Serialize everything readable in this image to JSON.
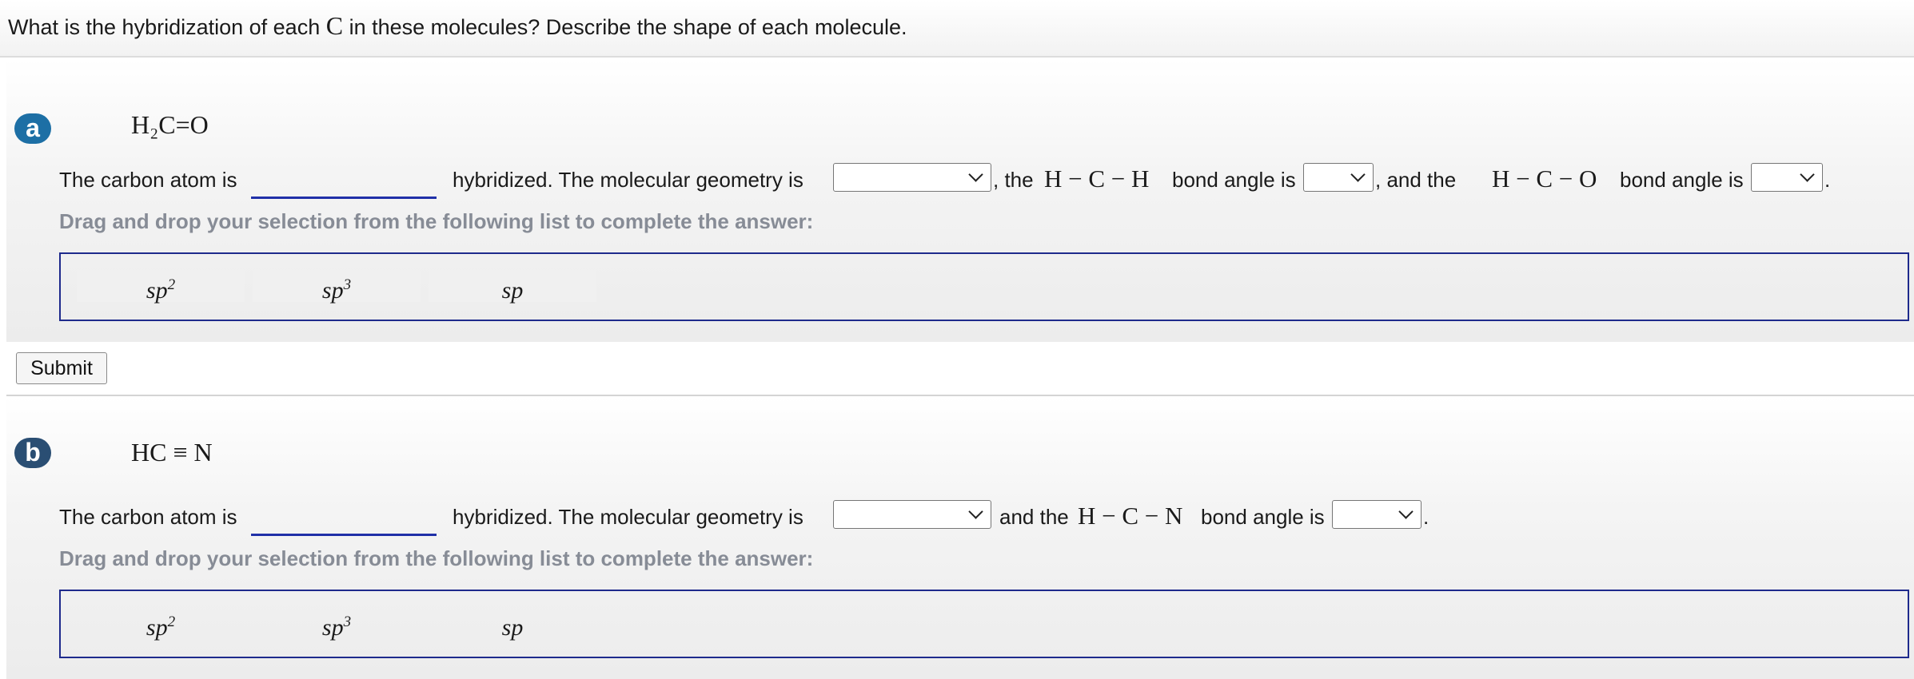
{
  "question": {
    "prefix": "What is the hybridization of each",
    "atom": "C",
    "suffix": "in these molecules? Describe the shape of each molecule."
  },
  "parts": [
    {
      "badge": "a",
      "formula": "H₂C=O",
      "carbon_text": "The carbon atom is",
      "hybrid_text": "hybridized. The molecular geometry is",
      "angle1_pre": ", the",
      "angle1_label": "H − C − H",
      "angle1_post": "bond angle is",
      "angle2_pre": ", and the",
      "angle2_label": "H − C − O",
      "angle2_post": "bond angle is",
      "end": ".",
      "instruction": "Drag and drop your selection from the following list to complete the answer:",
      "choices": [
        {
          "base": "sp",
          "sup": "2"
        },
        {
          "base": "sp",
          "sup": "3"
        },
        {
          "base": "sp",
          "sup": ""
        }
      ]
    },
    {
      "badge": "b",
      "formula": "HC ≡ N",
      "carbon_text": "The carbon atom is",
      "hybrid_text": "hybridized. The molecular geometry is",
      "angle1_pre": "and the",
      "angle1_label": "H − C − N",
      "angle1_post": "bond angle is",
      "end": ".",
      "instruction": "Drag and drop your selection from the following list to complete the answer:",
      "choices": [
        {
          "base": "sp",
          "sup": "2"
        },
        {
          "base": "sp",
          "sup": "3"
        },
        {
          "base": "sp",
          "sup": ""
        }
      ]
    }
  ],
  "submit_label": "Submit",
  "colors": {
    "badge_a": "#1d6fa5",
    "badge_b": "#2a4e73",
    "drop_border": "#1e2a8c",
    "blank_underline": "#2030a8",
    "instruction_text": "#878c96"
  }
}
